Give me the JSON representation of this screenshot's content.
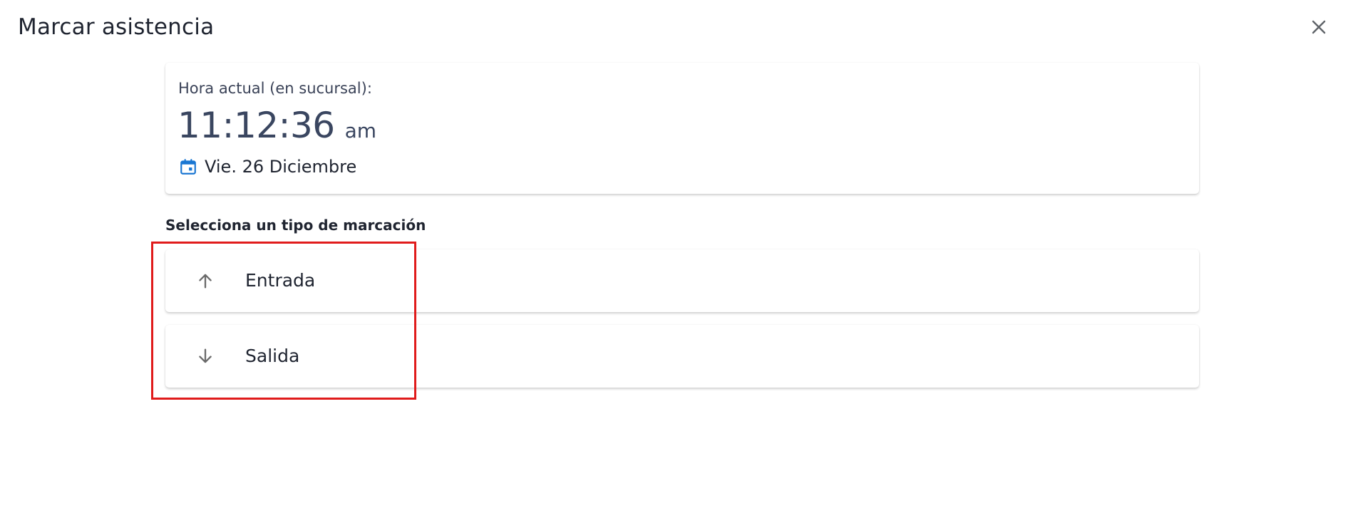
{
  "dialog": {
    "title": "Marcar asistencia",
    "close_icon": "close-icon"
  },
  "clock_card": {
    "label": "Hora actual (en sucursal):",
    "time": "11:12:36",
    "ampm": "am",
    "date_icon": "calendar-icon",
    "date": "Vie. 26 Diciembre"
  },
  "marking": {
    "section_label": "Selecciona un tipo de marcación",
    "options": [
      {
        "label": "Entrada",
        "icon": "arrow-up-icon"
      },
      {
        "label": "Salida",
        "icon": "arrow-down-icon"
      }
    ]
  },
  "colors": {
    "accent": "#1976d2",
    "highlight": "#e01b1b",
    "icon_gray": "#6b6b6b"
  }
}
